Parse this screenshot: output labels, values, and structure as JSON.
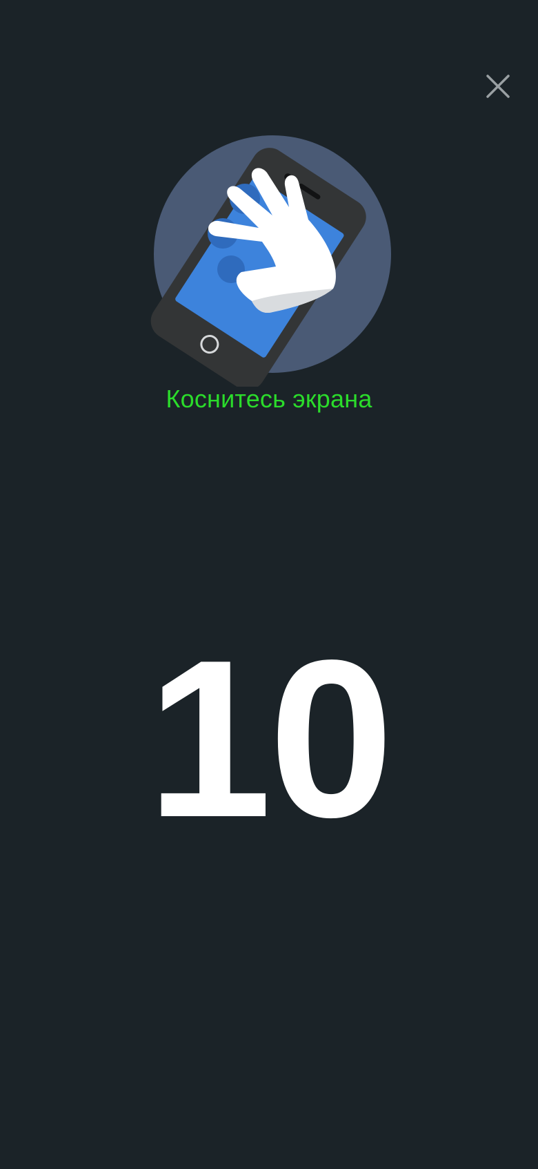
{
  "header": {
    "close_icon": "close-icon"
  },
  "illustration": {
    "icon": "phone-touch-hand-icon",
    "colors": {
      "circle": "#4a5a75",
      "phone_body": "#333536",
      "phone_screen": "#3d83dc",
      "hand": "#ffffff"
    }
  },
  "instruction": {
    "text": "Коснитесь экрана",
    "color": "#2bdc2b"
  },
  "countdown": {
    "value": "10"
  },
  "theme": {
    "background": "#1b2328"
  }
}
